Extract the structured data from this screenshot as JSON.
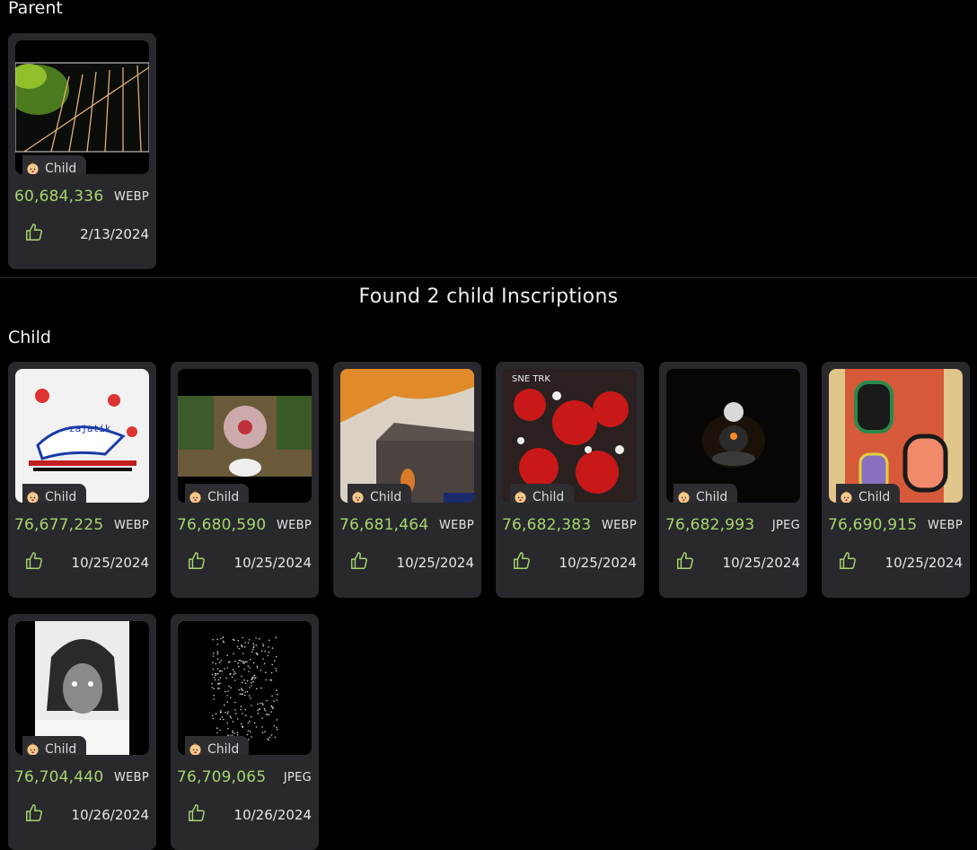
{
  "parent_section": {
    "title": "Parent"
  },
  "found_text": "Found 2 child Inscriptions",
  "child_section": {
    "title": "Child"
  },
  "badge_label": "Child",
  "parent_card": {
    "number": "60,684,336",
    "format": "WEBP",
    "date": "2/13/2024"
  },
  "children": [
    {
      "number": "76,677,225",
      "format": "WEBP",
      "date": "10/25/2024"
    },
    {
      "number": "76,680,590",
      "format": "WEBP",
      "date": "10/25/2024"
    },
    {
      "number": "76,681,464",
      "format": "WEBP",
      "date": "10/25/2024"
    },
    {
      "number": "76,682,383",
      "format": "WEBP",
      "date": "10/25/2024"
    },
    {
      "number": "76,682,993",
      "format": "JPEG",
      "date": "10/25/2024"
    },
    {
      "number": "76,690,915",
      "format": "WEBP",
      "date": "10/25/2024"
    },
    {
      "number": "76,704,440",
      "format": "WEBP",
      "date": "10/26/2024"
    },
    {
      "number": "76,709,065",
      "format": "JPEG",
      "date": "10/26/2024"
    }
  ],
  "icons": {
    "like": "thumbs-up-icon",
    "badge": "baby-face-icon"
  },
  "colors": {
    "number": "#a6d66b",
    "card_bg": "#29282d",
    "page_bg": "#000000"
  }
}
